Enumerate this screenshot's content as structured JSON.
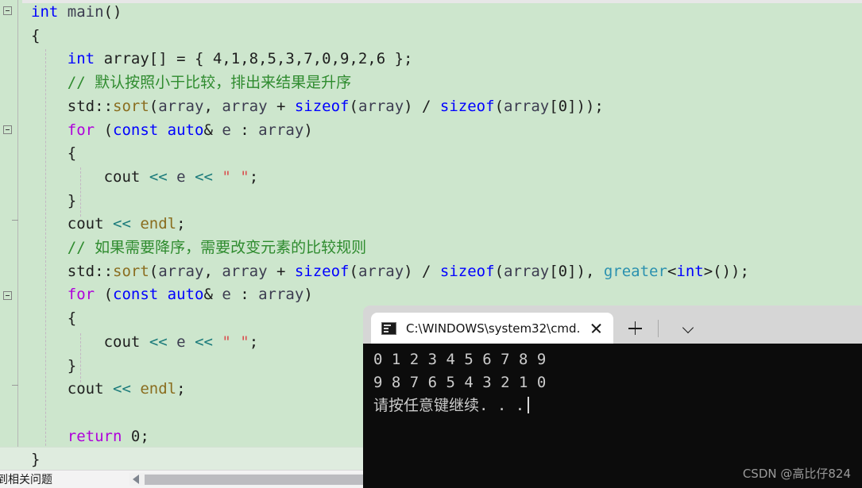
{
  "editor": {
    "background_color": "#cde6cd",
    "lines": [
      {
        "indent": 0,
        "tokens": [
          {
            "t": "int",
            "c": "kw"
          },
          {
            "t": " ",
            "c": "plain"
          },
          {
            "t": "main",
            "c": "id"
          },
          {
            "t": "()",
            "c": "plain"
          }
        ]
      },
      {
        "indent": 0,
        "tokens": [
          {
            "t": "{",
            "c": "plain"
          }
        ]
      },
      {
        "indent": 1,
        "tokens": [
          {
            "t": "int",
            "c": "kw"
          },
          {
            "t": " array[] = { 4,1,8,5,3,7,0,9,2,6 };",
            "c": "plain"
          }
        ]
      },
      {
        "indent": 1,
        "tokens": [
          {
            "t": "// 默认按照小于比较，排出来结果是升序",
            "c": "cmt"
          }
        ]
      },
      {
        "indent": 1,
        "tokens": [
          {
            "t": "std",
            "c": "plain"
          },
          {
            "t": "::",
            "c": "plain"
          },
          {
            "t": "sort",
            "c": "fn"
          },
          {
            "t": "(",
            "c": "plain"
          },
          {
            "t": "array",
            "c": "id"
          },
          {
            "t": ", ",
            "c": "plain"
          },
          {
            "t": "array",
            "c": "id"
          },
          {
            "t": " + ",
            "c": "plain"
          },
          {
            "t": "sizeof",
            "c": "kw"
          },
          {
            "t": "(",
            "c": "plain"
          },
          {
            "t": "array",
            "c": "id"
          },
          {
            "t": ") / ",
            "c": "plain"
          },
          {
            "t": "sizeof",
            "c": "kw"
          },
          {
            "t": "(",
            "c": "plain"
          },
          {
            "t": "array",
            "c": "id"
          },
          {
            "t": "[0]));",
            "c": "plain"
          }
        ]
      },
      {
        "indent": 1,
        "tokens": [
          {
            "t": "for",
            "c": "ctl"
          },
          {
            "t": " (",
            "c": "plain"
          },
          {
            "t": "const",
            "c": "kw"
          },
          {
            "t": " ",
            "c": "plain"
          },
          {
            "t": "auto",
            "c": "kw"
          },
          {
            "t": "& ",
            "c": "plain"
          },
          {
            "t": "e",
            "c": "id"
          },
          {
            "t": " : ",
            "c": "plain"
          },
          {
            "t": "array",
            "c": "id"
          },
          {
            "t": ")",
            "c": "plain"
          }
        ]
      },
      {
        "indent": 1,
        "tokens": [
          {
            "t": "{",
            "c": "plain"
          }
        ]
      },
      {
        "indent": 2,
        "tokens": [
          {
            "t": "cout",
            "c": "plain"
          },
          {
            "t": " ",
            "c": "plain"
          },
          {
            "t": "<<",
            "c": "op"
          },
          {
            "t": " ",
            "c": "plain"
          },
          {
            "t": "e",
            "c": "id"
          },
          {
            "t": " ",
            "c": "plain"
          },
          {
            "t": "<<",
            "c": "op"
          },
          {
            "t": " ",
            "c": "plain"
          },
          {
            "t": "\" \"",
            "c": "str"
          },
          {
            "t": ";",
            "c": "plain"
          }
        ]
      },
      {
        "indent": 1,
        "tokens": [
          {
            "t": "}",
            "c": "plain"
          }
        ]
      },
      {
        "indent": 1,
        "tokens": [
          {
            "t": "cout",
            "c": "plain"
          },
          {
            "t": " ",
            "c": "plain"
          },
          {
            "t": "<<",
            "c": "op"
          },
          {
            "t": " ",
            "c": "plain"
          },
          {
            "t": "endl",
            "c": "fn"
          },
          {
            "t": ";",
            "c": "plain"
          }
        ]
      },
      {
        "indent": 1,
        "tokens": [
          {
            "t": "// 如果需要降序，需要改变元素的比较规则",
            "c": "cmt"
          }
        ]
      },
      {
        "indent": 1,
        "tokens": [
          {
            "t": "std",
            "c": "plain"
          },
          {
            "t": "::",
            "c": "plain"
          },
          {
            "t": "sort",
            "c": "fn"
          },
          {
            "t": "(",
            "c": "plain"
          },
          {
            "t": "array",
            "c": "id"
          },
          {
            "t": ", ",
            "c": "plain"
          },
          {
            "t": "array",
            "c": "id"
          },
          {
            "t": " + ",
            "c": "plain"
          },
          {
            "t": "sizeof",
            "c": "kw"
          },
          {
            "t": "(",
            "c": "plain"
          },
          {
            "t": "array",
            "c": "id"
          },
          {
            "t": ") / ",
            "c": "plain"
          },
          {
            "t": "sizeof",
            "c": "kw"
          },
          {
            "t": "(",
            "c": "plain"
          },
          {
            "t": "array",
            "c": "id"
          },
          {
            "t": "[0]), ",
            "c": "plain"
          },
          {
            "t": "greater",
            "c": "cls"
          },
          {
            "t": "<",
            "c": "plain"
          },
          {
            "t": "int",
            "c": "kw"
          },
          {
            "t": ">());",
            "c": "plain"
          }
        ]
      },
      {
        "indent": 1,
        "tokens": [
          {
            "t": "for",
            "c": "ctl"
          },
          {
            "t": " (",
            "c": "plain"
          },
          {
            "t": "const",
            "c": "kw"
          },
          {
            "t": " ",
            "c": "plain"
          },
          {
            "t": "auto",
            "c": "kw"
          },
          {
            "t": "& ",
            "c": "plain"
          },
          {
            "t": "e",
            "c": "id"
          },
          {
            "t": " : ",
            "c": "plain"
          },
          {
            "t": "array",
            "c": "id"
          },
          {
            "t": ")",
            "c": "plain"
          }
        ]
      },
      {
        "indent": 1,
        "tokens": [
          {
            "t": "{",
            "c": "plain"
          }
        ]
      },
      {
        "indent": 2,
        "tokens": [
          {
            "t": "cout",
            "c": "plain"
          },
          {
            "t": " ",
            "c": "plain"
          },
          {
            "t": "<<",
            "c": "op"
          },
          {
            "t": " ",
            "c": "plain"
          },
          {
            "t": "e",
            "c": "id"
          },
          {
            "t": " ",
            "c": "plain"
          },
          {
            "t": "<<",
            "c": "op"
          },
          {
            "t": " ",
            "c": "plain"
          },
          {
            "t": "\" \"",
            "c": "str"
          },
          {
            "t": ";",
            "c": "plain"
          }
        ]
      },
      {
        "indent": 1,
        "tokens": [
          {
            "t": "}",
            "c": "plain"
          }
        ]
      },
      {
        "indent": 1,
        "tokens": [
          {
            "t": "cout",
            "c": "plain"
          },
          {
            "t": " ",
            "c": "plain"
          },
          {
            "t": "<<",
            "c": "op"
          },
          {
            "t": " ",
            "c": "plain"
          },
          {
            "t": "endl",
            "c": "fn"
          },
          {
            "t": ";",
            "c": "plain"
          }
        ]
      },
      {
        "indent": 0,
        "tokens": []
      },
      {
        "indent": 1,
        "tokens": [
          {
            "t": "return",
            "c": "ctl"
          },
          {
            "t": " ",
            "c": "plain"
          },
          {
            "t": "0",
            "c": "num"
          },
          {
            "t": ";",
            "c": "plain"
          }
        ]
      },
      {
        "indent": 0,
        "tokens": [
          {
            "t": "}",
            "c": "plain"
          }
        ]
      }
    ]
  },
  "statusbar": {
    "text": "到相关问题"
  },
  "terminal": {
    "tab_title": "C:\\WINDOWS\\system32\\cmd.",
    "output_lines": [
      "0 1 2 3 4 5 6 7 8 9",
      "9 8 7 6 5 4 3 2 1 0",
      "请按任意键继续. . ."
    ],
    "background_color": "#0c0c0c",
    "text_color": "#cccccc"
  },
  "watermark": {
    "text": "CSDN @高比仔824"
  }
}
